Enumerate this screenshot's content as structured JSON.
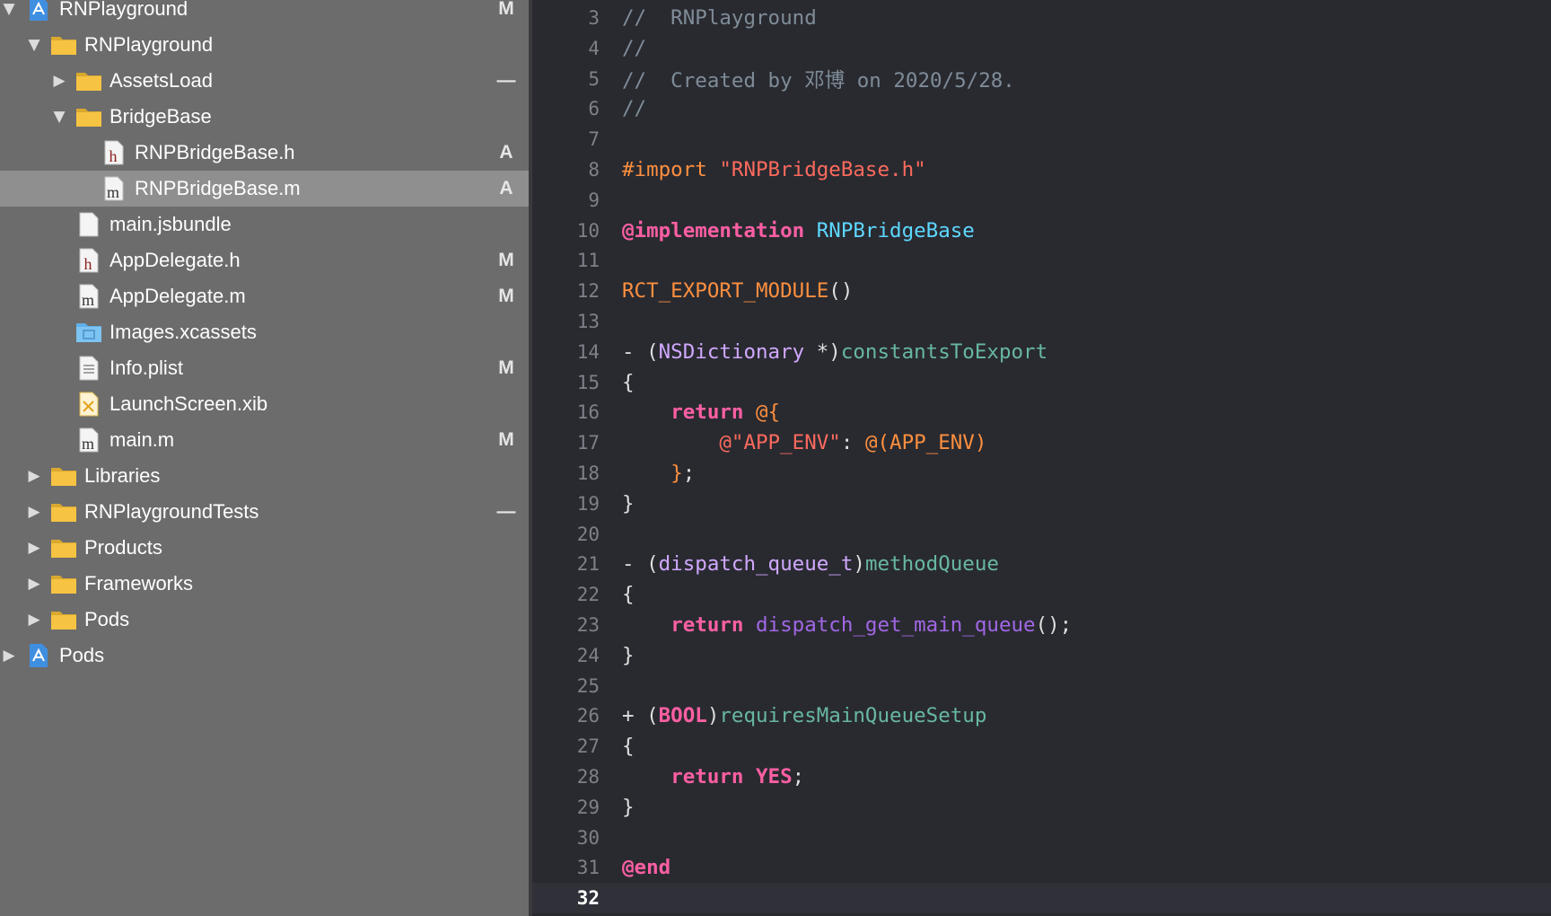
{
  "navigator": {
    "items": [
      {
        "depth": 0,
        "disclosure": "open",
        "icon": "project-icon",
        "label": "RNPlayground",
        "status": "M"
      },
      {
        "depth": 1,
        "disclosure": "open",
        "icon": "folder-icon",
        "label": "RNPlayground",
        "status": ""
      },
      {
        "depth": 2,
        "disclosure": "closed",
        "icon": "folder-icon",
        "label": "AssetsLoad",
        "status": "—"
      },
      {
        "depth": 2,
        "disclosure": "open",
        "icon": "folder-icon",
        "label": "BridgeBase",
        "status": ""
      },
      {
        "depth": 3,
        "disclosure": "none",
        "icon": "header-file-icon",
        "label": "RNPBridgeBase.h",
        "status": "A"
      },
      {
        "depth": 3,
        "disclosure": "none",
        "icon": "objc-file-icon",
        "label": "RNPBridgeBase.m",
        "status": "A",
        "selected": true
      },
      {
        "depth": 2,
        "disclosure": "none",
        "icon": "blank-file-icon",
        "label": "main.jsbundle",
        "status": ""
      },
      {
        "depth": 2,
        "disclosure": "none",
        "icon": "header-file-icon",
        "label": "AppDelegate.h",
        "status": "M"
      },
      {
        "depth": 2,
        "disclosure": "none",
        "icon": "objc-file-icon",
        "label": "AppDelegate.m",
        "status": "M"
      },
      {
        "depth": 2,
        "disclosure": "none",
        "icon": "asset-catalog-icon",
        "label": "Images.xcassets",
        "status": ""
      },
      {
        "depth": 2,
        "disclosure": "none",
        "icon": "plist-file-icon",
        "label": "Info.plist",
        "status": "M"
      },
      {
        "depth": 2,
        "disclosure": "none",
        "icon": "xib-file-icon",
        "label": "LaunchScreen.xib",
        "status": ""
      },
      {
        "depth": 2,
        "disclosure": "none",
        "icon": "objc-file-icon",
        "label": "main.m",
        "status": "M"
      },
      {
        "depth": 1,
        "disclosure": "closed",
        "icon": "folder-icon",
        "label": "Libraries",
        "status": ""
      },
      {
        "depth": 1,
        "disclosure": "closed",
        "icon": "folder-icon",
        "label": "RNPlaygroundTests",
        "status": "—"
      },
      {
        "depth": 1,
        "disclosure": "closed",
        "icon": "folder-icon",
        "label": "Products",
        "status": ""
      },
      {
        "depth": 1,
        "disclosure": "closed",
        "icon": "folder-icon",
        "label": "Frameworks",
        "status": ""
      },
      {
        "depth": 1,
        "disclosure": "closed",
        "icon": "folder-icon",
        "label": "Pods",
        "status": ""
      },
      {
        "depth": 0,
        "disclosure": "closed",
        "icon": "project-icon",
        "label": "Pods",
        "status": ""
      }
    ]
  },
  "editor": {
    "current_line": 32,
    "lines": [
      {
        "n": "3",
        "tokens": [
          [
            "comment",
            "//  RNPlayground"
          ]
        ]
      },
      {
        "n": "4",
        "tokens": [
          [
            "comment",
            "//"
          ]
        ]
      },
      {
        "n": "5",
        "tokens": [
          [
            "comment",
            "//  Created by 邓博 on 2020/5/28."
          ]
        ]
      },
      {
        "n": "6",
        "tokens": [
          [
            "comment",
            "//"
          ]
        ]
      },
      {
        "n": "7",
        "tokens": []
      },
      {
        "n": "8",
        "tokens": [
          [
            "preproc",
            "#import "
          ],
          [
            "string",
            "\"RNPBridgeBase.h\""
          ]
        ]
      },
      {
        "n": "9",
        "tokens": []
      },
      {
        "n": "10",
        "tokens": [
          [
            "keyword",
            "@implementation"
          ],
          [
            "plain",
            " "
          ],
          [
            "class",
            "RNPBridgeBase"
          ]
        ]
      },
      {
        "n": "11",
        "tokens": []
      },
      {
        "n": "12",
        "tokens": [
          [
            "macro",
            "RCT_EXPORT_MODULE"
          ],
          [
            "plain",
            "()"
          ]
        ]
      },
      {
        "n": "13",
        "tokens": []
      },
      {
        "n": "14",
        "tokens": [
          [
            "plain",
            "- ("
          ],
          [
            "type",
            "NSDictionary"
          ],
          [
            "plain",
            " *)"
          ],
          [
            "method",
            "constantsToExport"
          ]
        ]
      },
      {
        "n": "15",
        "tokens": [
          [
            "plain",
            "{"
          ]
        ]
      },
      {
        "n": "16",
        "tokens": [
          [
            "plain",
            "    "
          ],
          [
            "keyword",
            "return"
          ],
          [
            "plain",
            " "
          ],
          [
            "macro",
            "@{"
          ]
        ]
      },
      {
        "n": "17",
        "tokens": [
          [
            "plain",
            "        "
          ],
          [
            "string",
            "@\"APP_ENV\""
          ],
          [
            "plain",
            ": "
          ],
          [
            "macro",
            "@(APP_ENV)"
          ]
        ]
      },
      {
        "n": "18",
        "tokens": [
          [
            "plain",
            "    "
          ],
          [
            "macro",
            "}"
          ],
          [
            "plain",
            ";"
          ]
        ]
      },
      {
        "n": "19",
        "tokens": [
          [
            "plain",
            "}"
          ]
        ]
      },
      {
        "n": "20",
        "tokens": []
      },
      {
        "n": "21",
        "tokens": [
          [
            "plain",
            "- ("
          ],
          [
            "type",
            "dispatch_queue_t"
          ],
          [
            "plain",
            ")"
          ],
          [
            "method",
            "methodQueue"
          ]
        ]
      },
      {
        "n": "22",
        "tokens": [
          [
            "plain",
            "{"
          ]
        ]
      },
      {
        "n": "23",
        "tokens": [
          [
            "plain",
            "    "
          ],
          [
            "keyword",
            "return"
          ],
          [
            "plain",
            " "
          ],
          [
            "sysfunc",
            "dispatch_get_main_queue"
          ],
          [
            "plain",
            "();"
          ]
        ]
      },
      {
        "n": "24",
        "tokens": [
          [
            "plain",
            "}"
          ]
        ]
      },
      {
        "n": "25",
        "tokens": []
      },
      {
        "n": "26",
        "tokens": [
          [
            "plain",
            "+ ("
          ],
          [
            "keyword",
            "BOOL"
          ],
          [
            "plain",
            ")"
          ],
          [
            "method",
            "requiresMainQueueSetup"
          ]
        ]
      },
      {
        "n": "27",
        "tokens": [
          [
            "plain",
            "{"
          ]
        ]
      },
      {
        "n": "28",
        "tokens": [
          [
            "plain",
            "    "
          ],
          [
            "keyword",
            "return"
          ],
          [
            "plain",
            " "
          ],
          [
            "keyword",
            "YES"
          ],
          [
            "plain",
            ";"
          ]
        ]
      },
      {
        "n": "29",
        "tokens": [
          [
            "plain",
            "}"
          ]
        ]
      },
      {
        "n": "30",
        "tokens": []
      },
      {
        "n": "31",
        "tokens": [
          [
            "keyword",
            "@end"
          ]
        ]
      },
      {
        "n": "32",
        "tokens": []
      }
    ]
  },
  "annotation": {
    "type": "red-arrow",
    "points_to_line": "17",
    "color": "#e02020"
  },
  "colors": {
    "navigator_bg": "#6c6c6c",
    "selected_row_bg": "#8f8f8f",
    "editor_bg": "#292a30",
    "folder": "#f6c342",
    "comment": "#7f8c98",
    "keyword": "#fc5fa3",
    "string": "#fc6a5d",
    "class": "#5dd8ff",
    "type": "#d0a8ff",
    "method": "#67b7a4",
    "preproc": "#fd8f3f"
  }
}
